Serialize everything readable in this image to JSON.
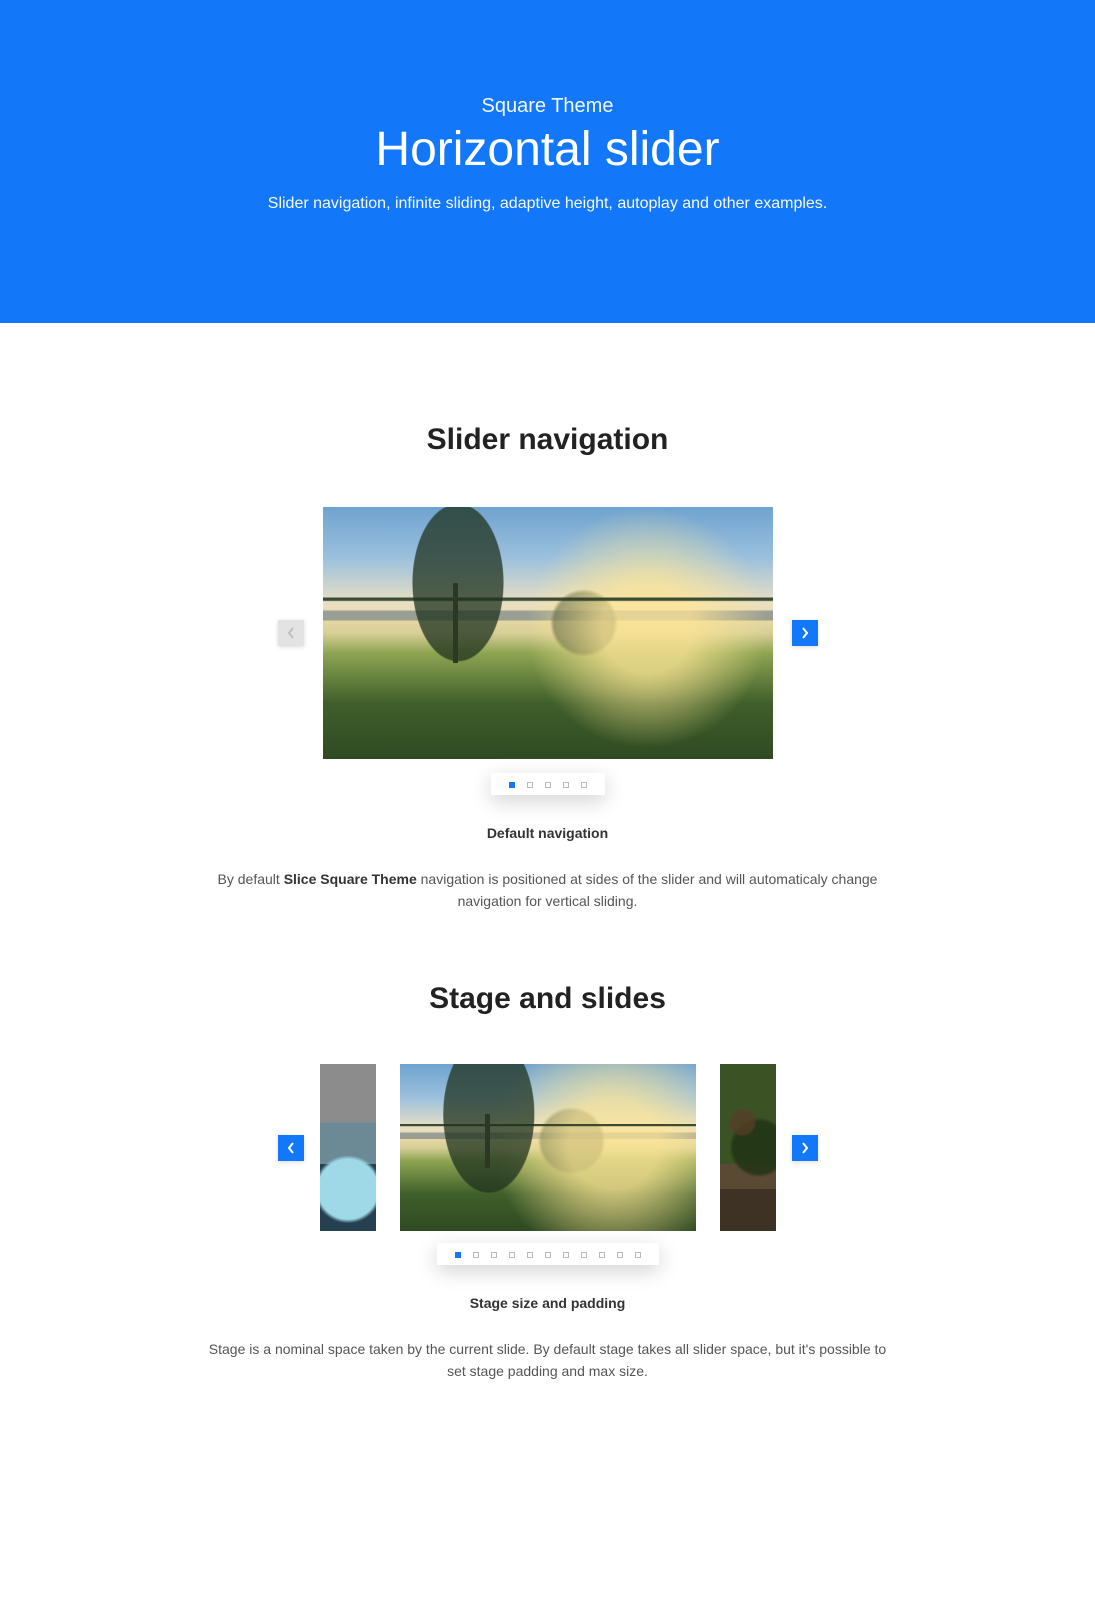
{
  "hero": {
    "theme_line": "Square Theme",
    "title": "Horizontal slider",
    "subtitle": "Slider navigation, infinite sliding, adaptive height, autoplay and other examples."
  },
  "sections": [
    {
      "heading": "Slider navigation",
      "dots_total": 5,
      "dots_active": 0,
      "prev_enabled": false,
      "next_enabled": true,
      "caption": "Default navigation",
      "para_pre": "By default ",
      "para_bold": "Slice Square Theme",
      "para_post": " navigation is positioned at sides of the slider and will automaticaly change navigation for vertical sliding."
    },
    {
      "heading": "Stage and slides",
      "dots_total": 11,
      "dots_active": 0,
      "prev_enabled": true,
      "next_enabled": true,
      "caption": "Stage size and padding",
      "para_pre": "Stage is a nominal space taken by the current slide. By default stage takes all slider space, but it's possible to set stage padding and max size.",
      "para_bold": "",
      "para_post": ""
    }
  ],
  "colors": {
    "accent": "#1277f9"
  }
}
